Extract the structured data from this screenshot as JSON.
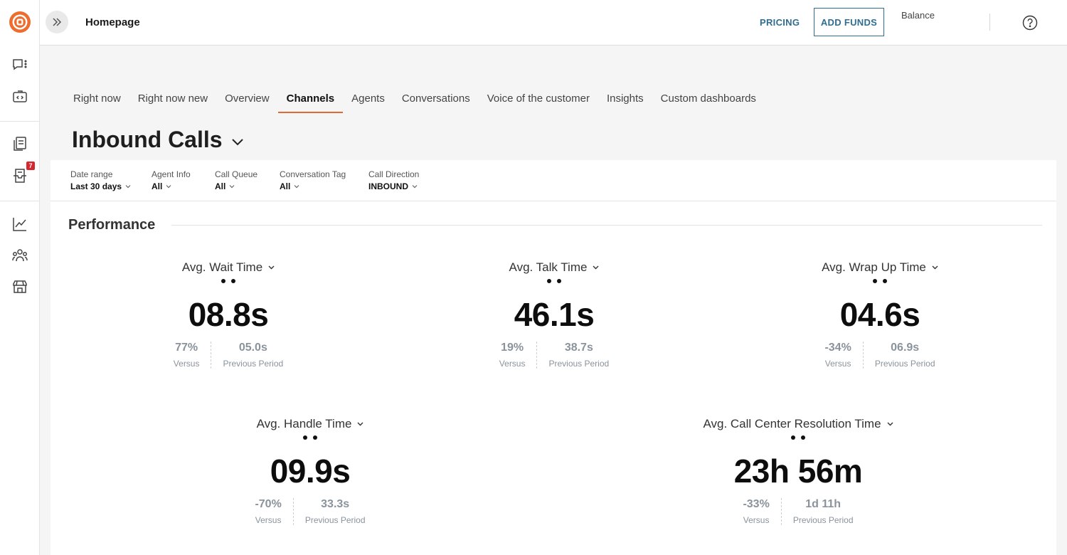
{
  "colors": {
    "accent": "#e06a35",
    "link": "#2f6d92",
    "badge": "#d6262e",
    "muted": "#8a939c"
  },
  "rail": {
    "logo_icon": "logo-icon",
    "icons": [
      "chat-menu-icon",
      "code-window-icon",
      "knowledge-base-icon",
      "inbox-icon",
      "analytics-chart-icon",
      "team-icon",
      "store-icon"
    ],
    "inbox_badge": "7"
  },
  "header": {
    "title": "Homepage",
    "pricing_label": "PRICING",
    "add_funds_label": "ADD FUNDS",
    "balance_label": "Balance"
  },
  "tabs": [
    {
      "label": "Right now"
    },
    {
      "label": "Right now new"
    },
    {
      "label": "Overview"
    },
    {
      "label": "Channels",
      "active": true
    },
    {
      "label": "Agents"
    },
    {
      "label": "Conversations"
    },
    {
      "label": "Voice of the customer"
    },
    {
      "label": "Insights"
    },
    {
      "label": "Custom dashboards"
    }
  ],
  "dashboard": {
    "title": "Inbound Calls"
  },
  "filters": [
    {
      "label": "Date range",
      "value": "Last 30 days"
    },
    {
      "label": "Agent Info",
      "value": "All"
    },
    {
      "label": "Call Queue",
      "value": "All"
    },
    {
      "label": "Conversation Tag",
      "value": "All"
    },
    {
      "label": "Call Direction",
      "value": "INBOUND"
    }
  ],
  "performance": {
    "title": "Performance",
    "metrics": [
      {
        "title": "Avg. Wait Time",
        "value": "08.8s",
        "versus": "77%",
        "versus_label": "Versus",
        "previous": "05.0s",
        "previous_label": "Previous Period"
      },
      {
        "title": "Avg. Talk Time",
        "value": "46.1s",
        "versus": "19%",
        "versus_label": "Versus",
        "previous": "38.7s",
        "previous_label": "Previous Period"
      },
      {
        "title": "Avg. Wrap Up Time",
        "value": "04.6s",
        "versus": "-34%",
        "versus_label": "Versus",
        "previous": "06.9s",
        "previous_label": "Previous Period"
      },
      {
        "title": "Avg. Handle Time",
        "value": "09.9s",
        "versus": "-70%",
        "versus_label": "Versus",
        "previous": "33.3s",
        "previous_label": "Previous Period"
      },
      {
        "title": "Avg. Call Center Resolution Time",
        "value": "23h 56m",
        "versus": "-33%",
        "versus_label": "Versus",
        "previous": "1d 11h",
        "previous_label": "Previous Period"
      }
    ]
  }
}
